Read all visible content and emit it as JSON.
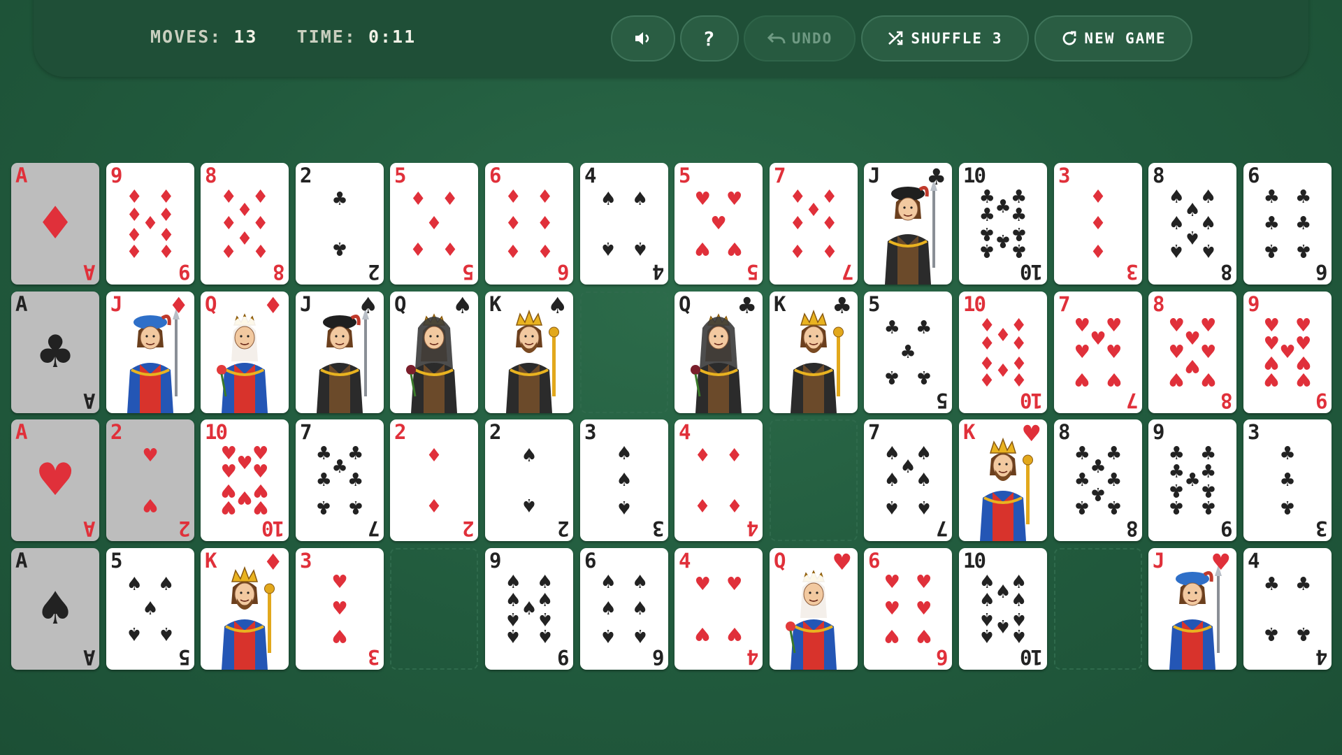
{
  "header": {
    "moves_label": "MOVES:",
    "moves_value": "13",
    "time_label": "TIME:",
    "time_value": "0:11"
  },
  "controls": {
    "sound_icon": "speaker-icon",
    "help_label": "?",
    "undo_label": "UNDO",
    "undo_enabled": false,
    "shuffle_label": "SHUFFLE",
    "shuffle_count": "3",
    "new_game_label": "NEW GAME"
  },
  "colors": {
    "felt": "#215a3d",
    "red_suit": "#e0303a",
    "black_suit": "#222222",
    "completed_card": "#bdbdbd"
  },
  "board": {
    "rows": [
      [
        "A♦*",
        "9♦",
        "8♦",
        "2♣",
        "5♦",
        "6♦",
        "4♠",
        "5♥",
        "7♦",
        "J♣",
        "10♣",
        "3♦",
        "8♠",
        "6♣"
      ],
      [
        "A♣*",
        "J♦",
        "Q♦",
        "J♠",
        "Q♠",
        "K♠",
        "",
        "Q♣",
        "K♣",
        "5♣",
        "10♦",
        "7♥",
        "8♥",
        "9♥"
      ],
      [
        "A♥*",
        "2♥*",
        "10♥",
        "7♣",
        "2♦",
        "2♠",
        "3♠",
        "4♦",
        "",
        "7♠",
        "K♥",
        "8♣",
        "9♣",
        "3♣"
      ],
      [
        "A♠*",
        "5♠",
        "K♦",
        "3♥",
        "",
        "9♠",
        "6♠",
        "4♥",
        "Q♥",
        "6♥",
        "10♠",
        "",
        "J♥",
        "4♣"
      ]
    ]
  }
}
